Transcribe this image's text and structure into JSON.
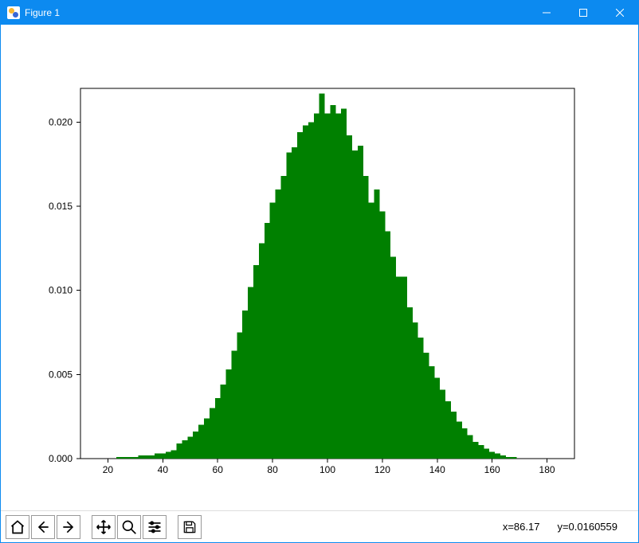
{
  "window": {
    "title": "Figure 1",
    "buttons": {
      "minimize": "Minimize",
      "maximize": "Maximize",
      "close": "Close"
    }
  },
  "toolbar": {
    "home": "Reset original view",
    "back": "Back to previous view",
    "forward": "Forward to next view",
    "pan": "Pan",
    "zoom": "Zoom",
    "configure": "Configure subplots",
    "save": "Save the figure"
  },
  "status": {
    "x_label": "x=86.17",
    "y_label": "y=0.0160559"
  },
  "chart_data": {
    "type": "bar",
    "title": "",
    "xlabel": "",
    "ylabel": "",
    "xlim": [
      10,
      190
    ],
    "ylim": [
      0,
      0.022
    ],
    "xticks": [
      20,
      40,
      60,
      80,
      100,
      120,
      140,
      160,
      180
    ],
    "yticks": [
      0.0,
      0.005,
      0.01,
      0.015,
      0.02
    ],
    "categories": [
      22,
      24,
      26,
      28,
      30,
      32,
      34,
      36,
      38,
      40,
      42,
      44,
      46,
      48,
      50,
      52,
      54,
      56,
      58,
      60,
      62,
      64,
      66,
      68,
      70,
      72,
      74,
      76,
      78,
      80,
      82,
      84,
      86,
      88,
      90,
      92,
      94,
      96,
      98,
      100,
      102,
      104,
      106,
      108,
      110,
      112,
      114,
      116,
      118,
      120,
      122,
      124,
      126,
      128,
      130,
      132,
      134,
      136,
      138,
      140,
      142,
      144,
      146,
      148,
      150,
      152,
      154,
      156,
      158,
      160,
      162,
      164,
      166,
      168
    ],
    "values": [
      0.0,
      0.0001,
      0.0001,
      0.0001,
      0.0001,
      0.0002,
      0.0002,
      0.0002,
      0.0003,
      0.0003,
      0.0004,
      0.0005,
      0.0009,
      0.0011,
      0.0013,
      0.0016,
      0.002,
      0.0024,
      0.003,
      0.0036,
      0.0044,
      0.0053,
      0.0064,
      0.0075,
      0.0088,
      0.0102,
      0.0115,
      0.0128,
      0.014,
      0.0152,
      0.016,
      0.0168,
      0.0182,
      0.0185,
      0.0194,
      0.0198,
      0.02,
      0.0205,
      0.0217,
      0.0205,
      0.021,
      0.0205,
      0.0208,
      0.0192,
      0.0183,
      0.0186,
      0.0168,
      0.0152,
      0.016,
      0.0147,
      0.0135,
      0.012,
      0.0108,
      0.0108,
      0.009,
      0.0081,
      0.0072,
      0.0063,
      0.0055,
      0.0048,
      0.0041,
      0.0034,
      0.0028,
      0.0022,
      0.0018,
      0.0014,
      0.001,
      0.0008,
      0.0006,
      0.0004,
      0.0003,
      0.0002,
      0.0001,
      0.0001
    ],
    "color": "#008000",
    "bin_width": 2
  }
}
